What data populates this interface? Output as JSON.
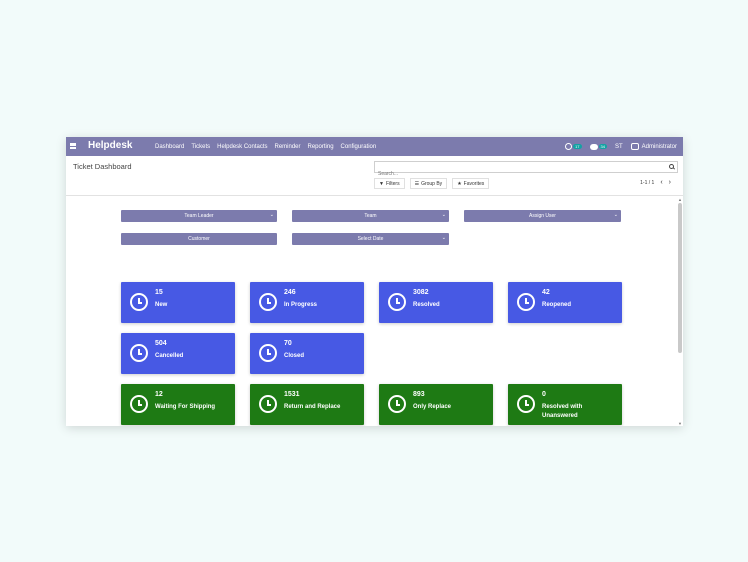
{
  "navbar": {
    "brand": "Helpdesk",
    "menu": [
      "Dashboard",
      "Tickets",
      "Helpdesk Contacts",
      "Reminder",
      "Reporting",
      "Configuration"
    ],
    "activity_badge": "17",
    "chat_badge": "34",
    "company_initials": "ST",
    "user": "Administrator"
  },
  "control": {
    "title": "Ticket Dashboard",
    "search_placeholder": "Search...",
    "filters_label": "Filters",
    "groupby_label": "Group By",
    "favorites_label": "Favorites",
    "pager": "1-1 / 1"
  },
  "selects": {
    "team_leader": "Team Leader",
    "team": "Team",
    "assign_user": "Assign User",
    "customer": "Customer",
    "select_date": "Select Date"
  },
  "cards": [
    {
      "count": "15",
      "label": "New",
      "color": "#4759e4"
    },
    {
      "count": "246",
      "label": "In Progress",
      "color": "#4759e4"
    },
    {
      "count": "3082",
      "label": "Resolved",
      "color": "#4759e4"
    },
    {
      "count": "42",
      "label": "Reopened",
      "color": "#4759e4"
    },
    {
      "count": "504",
      "label": "Cancelled",
      "color": "#4759e4"
    },
    {
      "count": "70",
      "label": "Closed",
      "color": "#4759e4"
    },
    {
      "count": "12",
      "label": "Waiting For Shipping",
      "color": "#1e7a14"
    },
    {
      "count": "1531",
      "label": "Return and Replace",
      "color": "#1e7a14"
    },
    {
      "count": "893",
      "label": "Only Replace",
      "color": "#1e7a14"
    },
    {
      "count": "0",
      "label": "Resolved with Unanswered",
      "color": "#1e7a14"
    }
  ],
  "colors": {
    "navbar": "#7c7bad",
    "blue_card": "#4759e4",
    "green_card": "#1e7a14"
  }
}
